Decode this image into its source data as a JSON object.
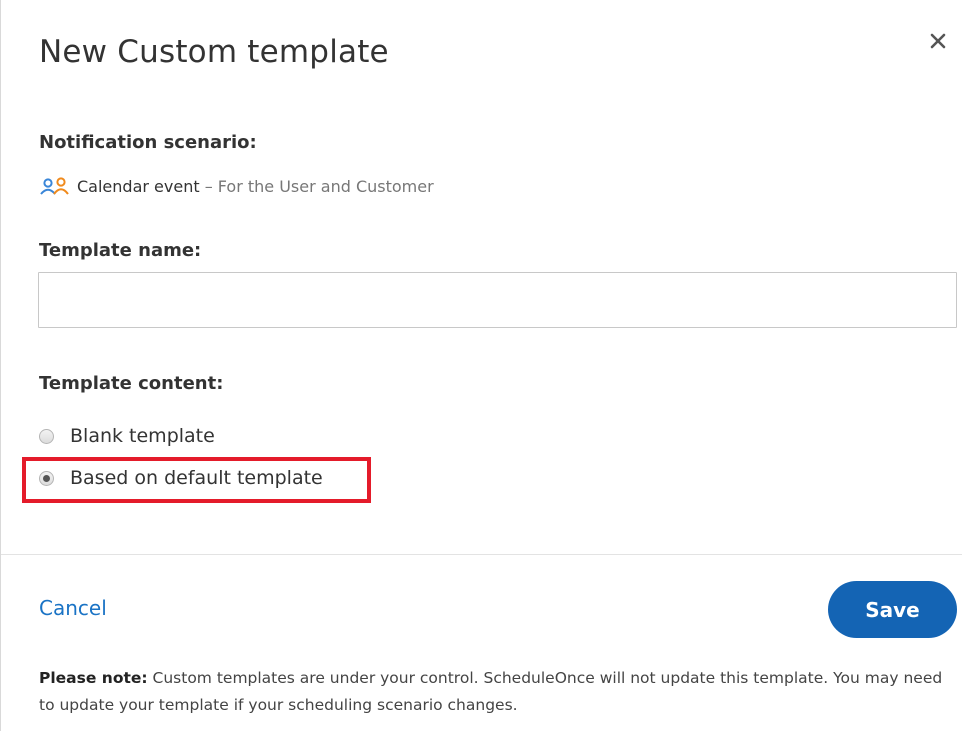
{
  "dialog": {
    "title": "New Custom template",
    "close_icon": "close-icon"
  },
  "scenario": {
    "label": "Notification scenario:",
    "icon": "user-customer-icon",
    "name": "Calendar event",
    "description": " – For the User and Customer"
  },
  "template_name": {
    "label": "Template name:",
    "value": "",
    "placeholder": ""
  },
  "template_content": {
    "label": "Template content:",
    "options": [
      {
        "label": "Blank template",
        "checked": false
      },
      {
        "label": "Based on default template",
        "checked": true
      }
    ]
  },
  "footer": {
    "cancel_label": "Cancel",
    "save_label": "Save",
    "note_bold": "Please note:",
    "note_text": " Custom templates are under your control. ScheduleOnce will not update this template. You may need to update your template if your scheduling scenario changes."
  },
  "colors": {
    "accent": "#1464b4",
    "link": "#1a73c5",
    "highlight": "#e41b2a"
  }
}
